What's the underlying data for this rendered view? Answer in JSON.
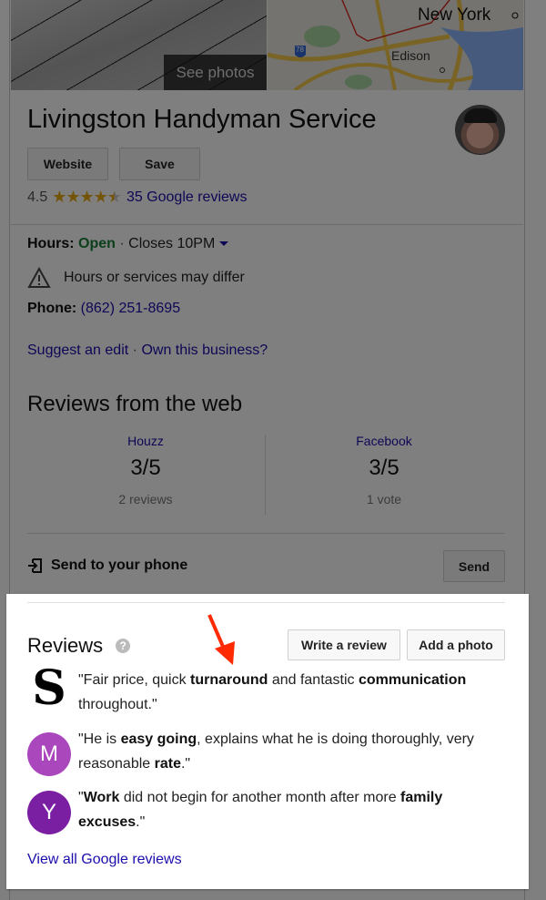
{
  "hero": {
    "see_photos_label": "See photos",
    "map_labels": {
      "city1": "New York",
      "city2": "Edison",
      "highway": "78"
    }
  },
  "business": {
    "name": "Livingston Handyman Service",
    "buttons": {
      "website": "Website",
      "save": "Save"
    },
    "rating": "4.5",
    "rating_value": 4.5,
    "rating_max": 5,
    "stars_full": "★★★★",
    "stars_half": "★",
    "reviews_link": "35 Google reviews"
  },
  "info": {
    "hours_label": "Hours:",
    "hours_status": "Open",
    "hours_sep": "·",
    "hours_close": "Closes 10PM",
    "warning": "Hours or services may differ",
    "phone_label": "Phone:",
    "phone": "(862) 251-8695",
    "suggest_edit": "Suggest an edit",
    "link_sep": "·",
    "own_business": "Own this business?"
  },
  "web_reviews": {
    "title": "Reviews from the web",
    "sources": [
      {
        "name": "Houzz",
        "score": "3/5",
        "count": "2 reviews"
      },
      {
        "name": "Facebook",
        "score": "3/5",
        "count": "1 vote"
      }
    ]
  },
  "send": {
    "label": "Send to your phone",
    "button": "Send"
  },
  "reviews": {
    "title": "Reviews",
    "help": "?",
    "write_button": "Write a review",
    "photo_button": "Add a photo",
    "items": [
      {
        "avatar_letter": "S",
        "avatar_color": "transparent",
        "parts": [
          "\"Fair price, quick ",
          "turnaround",
          " and fantastic ",
          "communication",
          " throughout.\""
        ]
      },
      {
        "avatar_letter": "M",
        "avatar_color": "#ab47bc",
        "parts": [
          "\"He is ",
          "easy going",
          ", explains what he is doing thoroughly, very reasonable ",
          "rate",
          ".\""
        ]
      },
      {
        "avatar_letter": "Y",
        "avatar_color": "#7b1fa2",
        "parts": [
          "\"",
          "Work",
          " did not begin for another month after more ",
          "family excuses",
          ".\""
        ]
      }
    ],
    "view_all": "View all Google reviews"
  },
  "colors": {
    "link": "#1a0dab",
    "open": "#188038",
    "star": "#e7a913",
    "annotation_arrow": "#ff2a00"
  }
}
